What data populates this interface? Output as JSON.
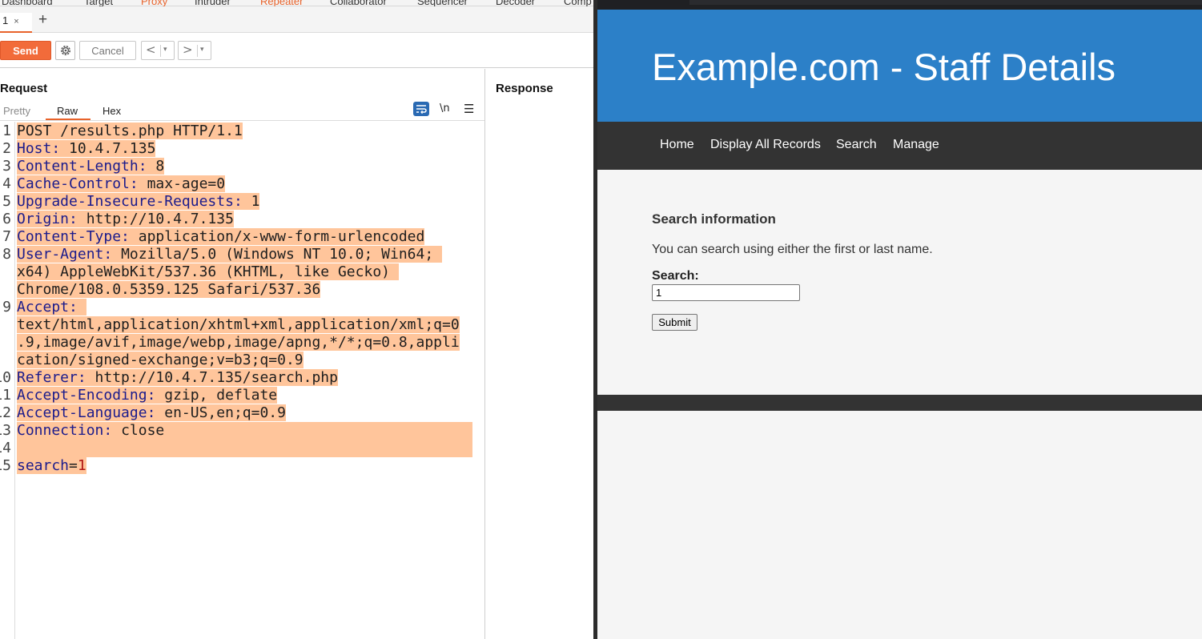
{
  "burp": {
    "top_tabs": [
      "Dashboard",
      "Target",
      "Proxy",
      "Intruder",
      "Repeater",
      "Collaborator",
      "Sequencer",
      "Decoder",
      "Comp"
    ],
    "sub_tab": {
      "label": "1",
      "close": "×"
    },
    "new_tab_glyph": "+",
    "toolbar": {
      "send_label": "Send",
      "cancel_label": "Cancel",
      "back_glyph": "<",
      "forward_glyph": ">",
      "dropdown_glyph": "▾"
    },
    "request": {
      "title": "Request",
      "tabs": [
        "Pretty",
        "Raw",
        "Hex"
      ],
      "active_tab": "Raw",
      "newline_label": "\\n",
      "menu_glyph": "☰",
      "lines": [
        {
          "n": "1",
          "k": "POST /results.php HTTP/1.1",
          "sep": "",
          "v": ""
        },
        {
          "n": "2",
          "k": "Host",
          "sep": ": ",
          "v": "10.4.7.135"
        },
        {
          "n": "3",
          "k": "Content-Length",
          "sep": ": ",
          "v": "8"
        },
        {
          "n": "4",
          "k": "Cache-Control",
          "sep": ": ",
          "v": "max-age=0"
        },
        {
          "n": "5",
          "k": "Upgrade-Insecure-Requests",
          "sep": ": ",
          "v": "1"
        },
        {
          "n": "6",
          "k": "Origin",
          "sep": ": ",
          "v": "http://10.4.7.135"
        },
        {
          "n": "7",
          "k": "Content-Type",
          "sep": ": ",
          "v": "application/x-www-form-urlencoded"
        },
        {
          "n": "8",
          "k": "User-Agent",
          "sep": ": ",
          "v": "Mozilla/5.0 (Windows NT 10.0; Win64; "
        },
        {
          "n": "",
          "k": "",
          "sep": "",
          "v": "x64) AppleWebKit/537.36 (KHTML, like Gecko) "
        },
        {
          "n": "",
          "k": "",
          "sep": "",
          "v": "Chrome/108.0.5359.125 Safari/537.36"
        },
        {
          "n": "9",
          "k": "Accept",
          "sep": ": ",
          "v": ""
        },
        {
          "n": "",
          "k": "",
          "sep": "",
          "v": "text/html,application/xhtml+xml,application/xml;q=0"
        },
        {
          "n": "",
          "k": "",
          "sep": "",
          "v": ".9,image/avif,image/webp,image/apng,*/*;q=0.8,appli"
        },
        {
          "n": "",
          "k": "",
          "sep": "",
          "v": "cation/signed-exchange;v=b3;q=0.9"
        },
        {
          "n": "10",
          "k": "Referer",
          "sep": ": ",
          "v": "http://10.4.7.135/search.php"
        },
        {
          "n": "11",
          "k": "Accept-Encoding",
          "sep": ": ",
          "v": "gzip, deflate"
        },
        {
          "n": "12",
          "k": "Accept-Language",
          "sep": ": ",
          "v": "en-US,en;q=0.9"
        },
        {
          "n": "13",
          "k": "Connection",
          "sep": ": ",
          "v": "close"
        },
        {
          "n": "14",
          "k": "",
          "sep": "",
          "v": ""
        },
        {
          "n": "15",
          "k": "search",
          "sep": "=",
          "v": "1"
        }
      ]
    },
    "response": {
      "title": "Response"
    }
  },
  "browser": {
    "site_title": "Example.com - Staff Details",
    "nav": [
      "Home",
      "Display All Records",
      "Search",
      "Manage"
    ],
    "section_heading": "Search information",
    "description": "You can search using either the first or last name.",
    "search_label": "Search:",
    "search_value": "1",
    "submit_label": "Submit"
  },
  "colors": {
    "burp_accent": "#e8632b",
    "send_button": "#f26b3a",
    "selection_highlight": "#ffc59b",
    "header_key": "#1b1b8c",
    "param_value": "#b01616",
    "site_header": "#2c80c8",
    "site_nav": "#333333"
  }
}
